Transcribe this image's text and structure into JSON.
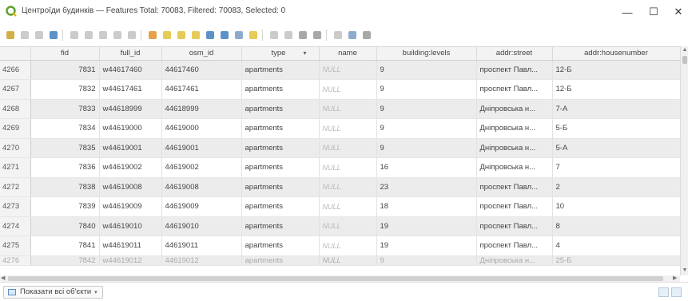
{
  "window": {
    "title": "Центроїди будинків — Features Total: 70083, Filtered: 70083, Selected: 0",
    "minimize_glyph": "—",
    "maximize_glyph": "☐",
    "close_glyph": "✕"
  },
  "toolbar": {
    "buttons": [
      {
        "name": "toggle-editing-icon",
        "color": "#c9a227"
      },
      {
        "name": "toggle-multi-edit-icon",
        "color": "#c2c2c2"
      },
      {
        "name": "save-edits-icon",
        "color": "#c2c2c2"
      },
      {
        "name": "reload-table-icon",
        "color": "#3f7fbf"
      },
      {
        "name": "add-feature-icon",
        "color": "#c2c2c2"
      },
      {
        "name": "delete-feature-icon",
        "color": "#c2c2c2"
      },
      {
        "name": "cut-icon",
        "color": "#c2c2c2"
      },
      {
        "name": "copy-icon",
        "color": "#c2c2c2"
      },
      {
        "name": "paste-icon",
        "color": "#c2c2c2"
      },
      {
        "name": "select-expression-icon",
        "color": "#e0902b"
      },
      {
        "name": "select-all-icon",
        "color": "#e2c23a"
      },
      {
        "name": "invert-selection-icon",
        "color": "#e2c23a"
      },
      {
        "name": "deselect-all-icon",
        "color": "#e2c23a"
      },
      {
        "name": "filter-select-icon",
        "color": "#3f7fbf"
      },
      {
        "name": "move-selection-top-icon",
        "color": "#3f7fbf"
      },
      {
        "name": "pan-to-selected-icon",
        "color": "#7a9cc6"
      },
      {
        "name": "zoom-to-selected-icon",
        "color": "#e2c23a"
      },
      {
        "name": "new-field-icon",
        "color": "#c2c2c2"
      },
      {
        "name": "delete-field-icon",
        "color": "#c2c2c2"
      },
      {
        "name": "field-calculator-icon",
        "color": "#999999"
      },
      {
        "name": "conditional-formatting-icon",
        "color": "#999999"
      },
      {
        "name": "actions-icon",
        "color": "#c2c2c2"
      },
      {
        "name": "zoom-map-icon",
        "color": "#7a9cc6"
      },
      {
        "name": "dock-table-icon",
        "color": "#999999"
      }
    ]
  },
  "table": {
    "columns": [
      "fid",
      "full_id",
      "osm_id",
      "type",
      "name",
      "building:levels",
      "addr:street",
      "addr:housenumber"
    ],
    "sort_indicator": "▾",
    "rows": [
      {
        "row": "4266",
        "fid": "7831",
        "full_id": "w44617460",
        "osm_id": "44617460",
        "type": "apartments",
        "name": "NULL",
        "levels": "9",
        "street": "проспект Павл...",
        "house": "12-Б"
      },
      {
        "row": "4267",
        "fid": "7832",
        "full_id": "w44617461",
        "osm_id": "44617461",
        "type": "apartments",
        "name": "NULL",
        "levels": "9",
        "street": "проспект Павл...",
        "house": "12-Б"
      },
      {
        "row": "4268",
        "fid": "7833",
        "full_id": "w44618999",
        "osm_id": "44618999",
        "type": "apartments",
        "name": "NULL",
        "levels": "9",
        "street": "Дніпровська н...",
        "house": "7-А"
      },
      {
        "row": "4269",
        "fid": "7834",
        "full_id": "w44619000",
        "osm_id": "44619000",
        "type": "apartments",
        "name": "NULL",
        "levels": "9",
        "street": "Дніпровська н...",
        "house": "5-Б"
      },
      {
        "row": "4270",
        "fid": "7835",
        "full_id": "w44619001",
        "osm_id": "44619001",
        "type": "apartments",
        "name": "NULL",
        "levels": "9",
        "street": "Дніпровська н...",
        "house": "5-А"
      },
      {
        "row": "4271",
        "fid": "7836",
        "full_id": "w44619002",
        "osm_id": "44619002",
        "type": "apartments",
        "name": "NULL",
        "levels": "16",
        "street": "Дніпровська н...",
        "house": "7"
      },
      {
        "row": "4272",
        "fid": "7838",
        "full_id": "w44619008",
        "osm_id": "44619008",
        "type": "apartments",
        "name": "NULL",
        "levels": "23",
        "street": "проспект Павл...",
        "house": "2"
      },
      {
        "row": "4273",
        "fid": "7839",
        "full_id": "w44619009",
        "osm_id": "44619009",
        "type": "apartments",
        "name": "NULL",
        "levels": "18",
        "street": "проспект Павл...",
        "house": "10"
      },
      {
        "row": "4274",
        "fid": "7840",
        "full_id": "w44619010",
        "osm_id": "44619010",
        "type": "apartments",
        "name": "NULL",
        "levels": "19",
        "street": "проспект Павл...",
        "house": "8"
      },
      {
        "row": "4275",
        "fid": "7841",
        "full_id": "w44619011",
        "osm_id": "44619011",
        "type": "apartments",
        "name": "NULL",
        "levels": "19",
        "street": "проспект Павл...",
        "house": "4"
      }
    ],
    "partial_row": {
      "row": "4276",
      "fid": "7842",
      "full_id": "w44619012",
      "osm_id": "44619012",
      "type": "apartments",
      "name": "NULL",
      "levels": "9",
      "street": "Дніпровська н...",
      "house": "25-Б"
    }
  },
  "statusbar": {
    "filter_label": "Показати всі об'єкти",
    "filter_caret": "▾"
  },
  "colors": {
    "accent": "#3f7fbf",
    "null_text": "#b9b9b9",
    "alt_row": "#ececec"
  }
}
